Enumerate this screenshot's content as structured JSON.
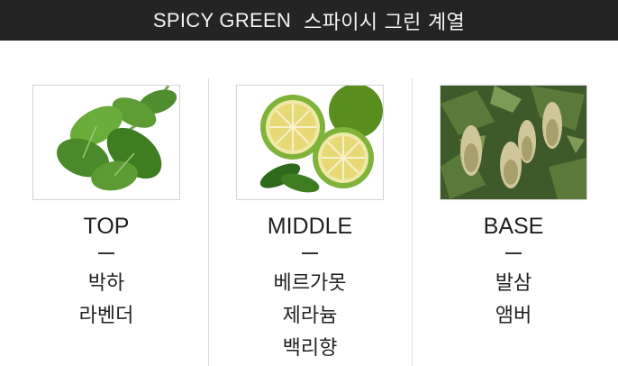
{
  "header": {
    "title_en": "SPICY GREEN",
    "title_ko": "스파이시 그린 계열"
  },
  "colors": {
    "header_bg": "#242424",
    "header_text": "#f4f4f4",
    "divider": "#dcdcdc"
  },
  "columns": [
    {
      "label": "TOP",
      "image": "mint-leaves",
      "notes": [
        "박하",
        "라벤더"
      ]
    },
    {
      "label": "MIDDLE",
      "image": "bergamot-citrus",
      "notes": [
        "베르가못",
        "제라늄",
        "백리향"
      ]
    },
    {
      "label": "BASE",
      "image": "fir-balsam",
      "notes": [
        "발삼",
        "앰버"
      ]
    }
  ]
}
